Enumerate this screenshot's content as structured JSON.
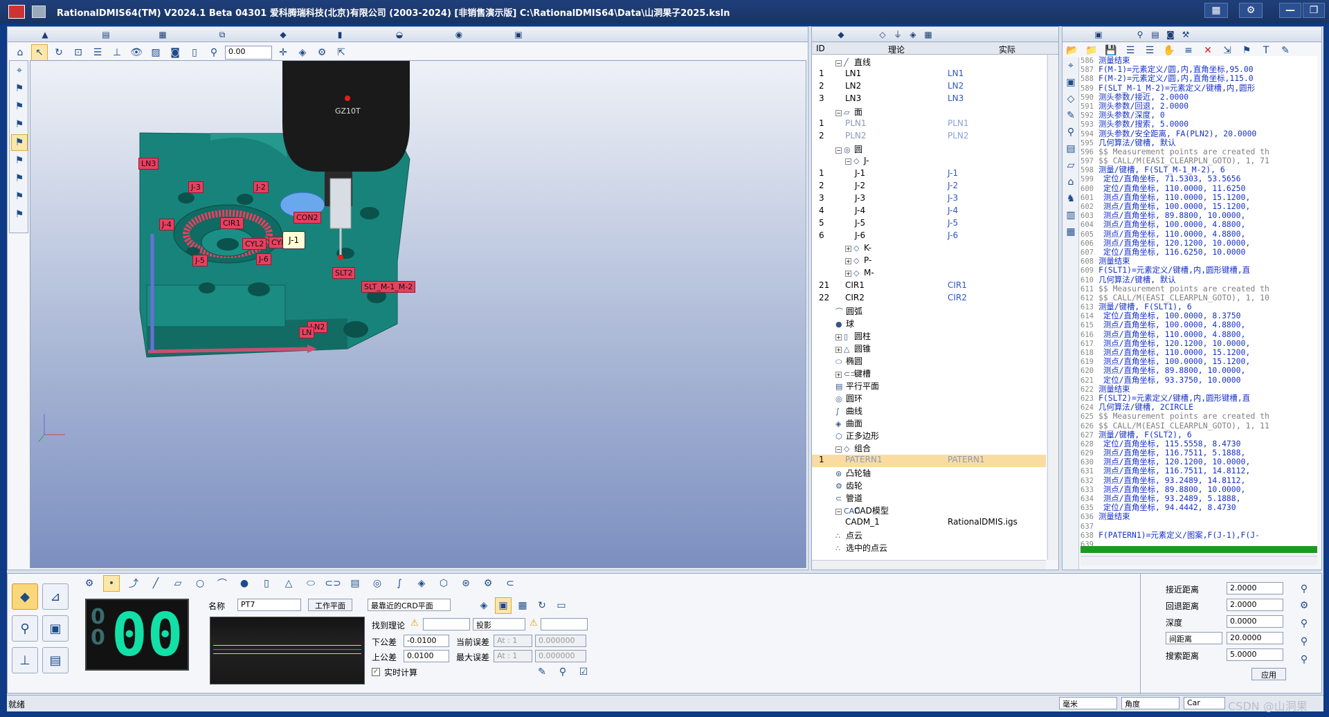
{
  "window": {
    "title": "RationalDMIS64(TM) V2024.1 Beta 04301  爱科腾瑞科技(北京)有限公司 (2003-2024) [非销售演示版]  C:\\RationalDMIS64\\Data\\山洞果子2025.ksln",
    "minimize": "—",
    "maximize": "❐"
  },
  "toolbar": {
    "value_field": "0.00"
  },
  "viewport": {
    "probe_name": "GZ10T",
    "labels": [
      "LN3",
      "J-3",
      "J-2",
      "CIR1",
      "J-4",
      "CYL2",
      "CYL",
      "CON2",
      "J-5",
      "J-6",
      "SLT2",
      "SLT_M-1_M-2",
      "LN2",
      "LN"
    ],
    "callout": "J-1"
  },
  "tree": {
    "col_id": "ID",
    "col_nominal": "理论",
    "col_actual": "实际",
    "rows": [
      {
        "id": "",
        "name": "直线",
        "act": "",
        "icon": "╱",
        "indent": 0,
        "exp": "−"
      },
      {
        "id": "1",
        "name": "LN1",
        "act": "LN1",
        "icon": "",
        "indent": 1,
        "exp": ""
      },
      {
        "id": "2",
        "name": "LN2",
        "act": "LN2",
        "icon": "",
        "indent": 1,
        "exp": ""
      },
      {
        "id": "3",
        "name": "LN3",
        "act": "LN3",
        "icon": "",
        "indent": 1,
        "exp": ""
      },
      {
        "id": "",
        "name": "面",
        "act": "",
        "icon": "▱",
        "indent": 0,
        "exp": "−"
      },
      {
        "id": "1",
        "name": "PLN1",
        "act": "PLN1",
        "icon": "",
        "indent": 1,
        "exp": "",
        "faded": true
      },
      {
        "id": "2",
        "name": "PLN2",
        "act": "PLN2",
        "icon": "",
        "indent": 1,
        "exp": "",
        "faded": true
      },
      {
        "id": "",
        "name": "圆",
        "act": "",
        "icon": "◎",
        "indent": 0,
        "exp": "−"
      },
      {
        "id": "",
        "name": "J-",
        "act": "",
        "icon": "◇",
        "indent": 1,
        "exp": "−"
      },
      {
        "id": "1",
        "name": "J-1",
        "act": "J-1",
        "icon": "",
        "indent": 2,
        "exp": ""
      },
      {
        "id": "2",
        "name": "J-2",
        "act": "J-2",
        "icon": "",
        "indent": 2,
        "exp": ""
      },
      {
        "id": "3",
        "name": "J-3",
        "act": "J-3",
        "icon": "",
        "indent": 2,
        "exp": ""
      },
      {
        "id": "4",
        "name": "J-4",
        "act": "J-4",
        "icon": "",
        "indent": 2,
        "exp": ""
      },
      {
        "id": "5",
        "name": "J-5",
        "act": "J-5",
        "icon": "",
        "indent": 2,
        "exp": ""
      },
      {
        "id": "6",
        "name": "J-6",
        "act": "J-6",
        "icon": "",
        "indent": 2,
        "exp": ""
      },
      {
        "id": "",
        "name": "K-",
        "act": "",
        "icon": "◇",
        "indent": 1,
        "exp": "+"
      },
      {
        "id": "",
        "name": "P-",
        "act": "",
        "icon": "◇",
        "indent": 1,
        "exp": "+"
      },
      {
        "id": "",
        "name": "M-",
        "act": "",
        "icon": "◇",
        "indent": 1,
        "exp": "+"
      },
      {
        "id": "21",
        "name": "CIR1",
        "act": "CIR1",
        "icon": "",
        "indent": 1,
        "exp": ""
      },
      {
        "id": "22",
        "name": "CIR2",
        "act": "CIR2",
        "icon": "",
        "indent": 1,
        "exp": ""
      },
      {
        "id": "",
        "name": "圆弧",
        "act": "",
        "icon": "⌒",
        "indent": 0,
        "exp": ""
      },
      {
        "id": "",
        "name": "球",
        "act": "",
        "icon": "●",
        "indent": 0,
        "exp": ""
      },
      {
        "id": "",
        "name": "圆柱",
        "act": "",
        "icon": "▯",
        "indent": 0,
        "exp": "+"
      },
      {
        "id": "",
        "name": "圆锥",
        "act": "",
        "icon": "△",
        "indent": 0,
        "exp": "+"
      },
      {
        "id": "",
        "name": "椭圆",
        "act": "",
        "icon": "⬭",
        "indent": 0,
        "exp": ""
      },
      {
        "id": "",
        "name": "键槽",
        "act": "",
        "icon": "⊂⊃",
        "indent": 0,
        "exp": "+"
      },
      {
        "id": "",
        "name": "平行平面",
        "act": "",
        "icon": "▤",
        "indent": 0,
        "exp": ""
      },
      {
        "id": "",
        "name": "圆环",
        "act": "",
        "icon": "◎",
        "indent": 0,
        "exp": ""
      },
      {
        "id": "",
        "name": "曲线",
        "act": "",
        "icon": "∫",
        "indent": 0,
        "exp": ""
      },
      {
        "id": "",
        "name": "曲面",
        "act": "",
        "icon": "◈",
        "indent": 0,
        "exp": ""
      },
      {
        "id": "",
        "name": "正多边形",
        "act": "",
        "icon": "⬡",
        "indent": 0,
        "exp": ""
      },
      {
        "id": "",
        "name": "组合",
        "act": "",
        "icon": "◇",
        "indent": 0,
        "exp": "−"
      },
      {
        "id": "1",
        "name": "PATERN1",
        "act": "PATERN1",
        "icon": "",
        "indent": 1,
        "exp": "",
        "sel": true,
        "faded": true
      },
      {
        "id": "",
        "name": "凸轮轴",
        "act": "",
        "icon": "⊛",
        "indent": 0,
        "exp": ""
      },
      {
        "id": "",
        "name": "齿轮",
        "act": "",
        "icon": "⚙",
        "indent": 0,
        "exp": ""
      },
      {
        "id": "",
        "name": "管道",
        "act": "",
        "icon": "⊂",
        "indent": 0,
        "exp": ""
      },
      {
        "id": "",
        "name": "CAD模型",
        "act": "",
        "icon": "CAD",
        "indent": 0,
        "exp": "−"
      },
      {
        "id": "",
        "name": "CADM_1",
        "act": "RationalDMIS.igs",
        "icon": "",
        "indent": 1,
        "exp": "",
        "black": true
      },
      {
        "id": "",
        "name": "点云",
        "act": "",
        "icon": "∴",
        "indent": 0,
        "exp": ""
      },
      {
        "id": "",
        "name": "选中的点云",
        "act": "",
        "icon": "∴",
        "indent": 0,
        "exp": ""
      }
    ]
  },
  "code_lines": [
    {
      "n": "586",
      "t": "测量结束",
      "c": "blue"
    },
    {
      "n": "587",
      "t": "F(M-1)=元素定义/圆,内,直角坐标,95.00",
      "c": "blue"
    },
    {
      "n": "588",
      "t": "F(M-2)=元素定义/圆,内,直角坐标,115.0",
      "c": "blue"
    },
    {
      "n": "589",
      "t": "F(SLT_M-1_M-2)=元素定义/键槽,内,圆形",
      "c": "blue"
    },
    {
      "n": "590",
      "t": "测头参数/接近, 2.0000",
      "c": "blue"
    },
    {
      "n": "591",
      "t": "测头参数/回退, 2.0000",
      "c": "blue"
    },
    {
      "n": "592",
      "t": "测头参数/深度, 0",
      "c": "blue"
    },
    {
      "n": "593",
      "t": "测头参数/搜索, 5.0000",
      "c": "blue"
    },
    {
      "n": "594",
      "t": "测头参数/安全距离, FA(PLN2), 20.0000",
      "c": "blue"
    },
    {
      "n": "595",
      "t": "几何算法/键槽, 默认",
      "c": "blue"
    },
    {
      "n": "596",
      "t": "$$ Measurement points are created th",
      "c": "gray"
    },
    {
      "n": "597",
      "t": "$$ CALL/M(EASI_CLEARPLN_GOTO), 1, 71",
      "c": "gray"
    },
    {
      "n": "598",
      "t": "测量/键槽, F(SLT_M-1_M-2), 6",
      "c": "blue"
    },
    {
      "n": "599",
      "t": "  定位/直角坐标,    71.5303, 53.5656",
      "c": "blue"
    },
    {
      "n": "600",
      "t": "  定位/直角坐标,   110.0000, 11.6250",
      "c": "blue"
    },
    {
      "n": "601",
      "t": "  测点/直角坐标, 110.0000, 15.1200,",
      "c": "blue"
    },
    {
      "n": "602",
      "t": "  测点/直角坐标, 100.0000, 15.1200,",
      "c": "blue"
    },
    {
      "n": "603",
      "t": "  测点/直角坐标,  89.8800, 10.0000,",
      "c": "blue"
    },
    {
      "n": "604",
      "t": "  测点/直角坐标, 100.0000,  4.8800,",
      "c": "blue"
    },
    {
      "n": "605",
      "t": "  测点/直角坐标, 110.0000,  4.8800,",
      "c": "blue"
    },
    {
      "n": "606",
      "t": "  测点/直角坐标, 120.1200, 10.0000,",
      "c": "blue"
    },
    {
      "n": "607",
      "t": "  定位/直角坐标,   116.6250, 10.0000",
      "c": "blue"
    },
    {
      "n": "608",
      "t": "测量结束",
      "c": "blue"
    },
    {
      "n": "609",
      "t": "F(SLT1)=元素定义/键槽,内,圆形键槽,直",
      "c": "blue"
    },
    {
      "n": "610",
      "t": "几何算法/键槽, 默认",
      "c": "blue"
    },
    {
      "n": "611",
      "t": "$$ Measurement points are created th",
      "c": "gray"
    },
    {
      "n": "612",
      "t": "$$ CALL/M(EASI_CLEARPLN_GOTO), 1, 10",
      "c": "gray"
    },
    {
      "n": "613",
      "t": "测量/键槽, F(SLT1), 6",
      "c": "blue"
    },
    {
      "n": "614",
      "t": "  定位/直角坐标,   100.0000,  8.3750",
      "c": "blue"
    },
    {
      "n": "615",
      "t": "  测点/直角坐标, 100.0000,  4.8800,",
      "c": "blue"
    },
    {
      "n": "616",
      "t": "  测点/直角坐标, 110.0000,  4.8800,",
      "c": "blue"
    },
    {
      "n": "617",
      "t": "  测点/直角坐标, 120.1200, 10.0000,",
      "c": "blue"
    },
    {
      "n": "618",
      "t": "  测点/直角坐标, 110.0000, 15.1200,",
      "c": "blue"
    },
    {
      "n": "619",
      "t": "  测点/直角坐标, 100.0000, 15.1200,",
      "c": "blue"
    },
    {
      "n": "620",
      "t": "  测点/直角坐标,  89.8800, 10.0000,",
      "c": "blue"
    },
    {
      "n": "621",
      "t": "  定位/直角坐标,    93.3750, 10.0000",
      "c": "blue"
    },
    {
      "n": "622",
      "t": "测量结束",
      "c": "blue"
    },
    {
      "n": "623",
      "t": "F(SLT2)=元素定义/键槽,内,圆形键槽,直",
      "c": "blue"
    },
    {
      "n": "624",
      "t": "几何算法/键槽, 2CIRCLE",
      "c": "blue"
    },
    {
      "n": "625",
      "t": "$$ Measurement points are created th",
      "c": "gray"
    },
    {
      "n": "626",
      "t": "$$ CALL/M(EASI_CLEARPLN_GOTO), 1, 11",
      "c": "gray"
    },
    {
      "n": "627",
      "t": "测量/键槽, F(SLT2), 6",
      "c": "blue"
    },
    {
      "n": "628",
      "t": "  定位/直角坐标,   115.5558,  8.4730",
      "c": "blue"
    },
    {
      "n": "629",
      "t": "  测点/直角坐标, 116.7511,  5.1888,",
      "c": "blue"
    },
    {
      "n": "630",
      "t": "  测点/直角坐标, 120.1200, 10.0000,",
      "c": "blue"
    },
    {
      "n": "631",
      "t": "  测点/直角坐标, 116.7511, 14.8112,",
      "c": "blue"
    },
    {
      "n": "632",
      "t": "  测点/直角坐标,  93.2489, 14.8112,",
      "c": "blue"
    },
    {
      "n": "633",
      "t": "  测点/直角坐标,  89.8800, 10.0000,",
      "c": "blue"
    },
    {
      "n": "634",
      "t": "  测点/直角坐标,  93.2489,  5.1888,",
      "c": "blue"
    },
    {
      "n": "635",
      "t": "  定位/直角坐标,    94.4442,  8.4730",
      "c": "blue"
    },
    {
      "n": "636",
      "t": "测量结束",
      "c": "blue"
    },
    {
      "n": "637",
      "t": "",
      "c": "blue"
    },
    {
      "n": "638",
      "t": "F(PATERN1)=元素定义/图案,F(J-1),F(J-",
      "c": "blue"
    },
    {
      "n": "639",
      "t": "",
      "c": "blue"
    }
  ],
  "bottom": {
    "counter": "00",
    "name_label": "名称",
    "name_value": "PT7",
    "work_plane": "工作平面",
    "crd_plane": "最靠近的CRD平面",
    "find_nominal": "找到理论",
    "projection": "投影",
    "lower_tol_label": "下公差",
    "lower_tol": "-0.0100",
    "upper_tol_label": "上公差",
    "upper_tol": "0.0100",
    "cur_err_label": "当前误差",
    "max_err_label": "最大误差",
    "at1": "At : 1",
    "at2": "At : 1",
    "err1": "0.000000",
    "err2": "0.000000",
    "realtime": "实时计算"
  },
  "params": {
    "approach_label": "接近距离",
    "approach": "2.0000",
    "retract_label": "回退距离",
    "retract": "2.0000",
    "depth_label": "深度",
    "depth": "0.0000",
    "gap_label": "间距离",
    "gap": "20.0000",
    "search_label": "搜索距离",
    "search": "5.0000",
    "apply": "应用"
  },
  "status": {
    "text": "就绪",
    "unit": "毫米",
    "angle": "角度",
    "cart": "Car"
  },
  "watermark": "CSDN @山洞果"
}
